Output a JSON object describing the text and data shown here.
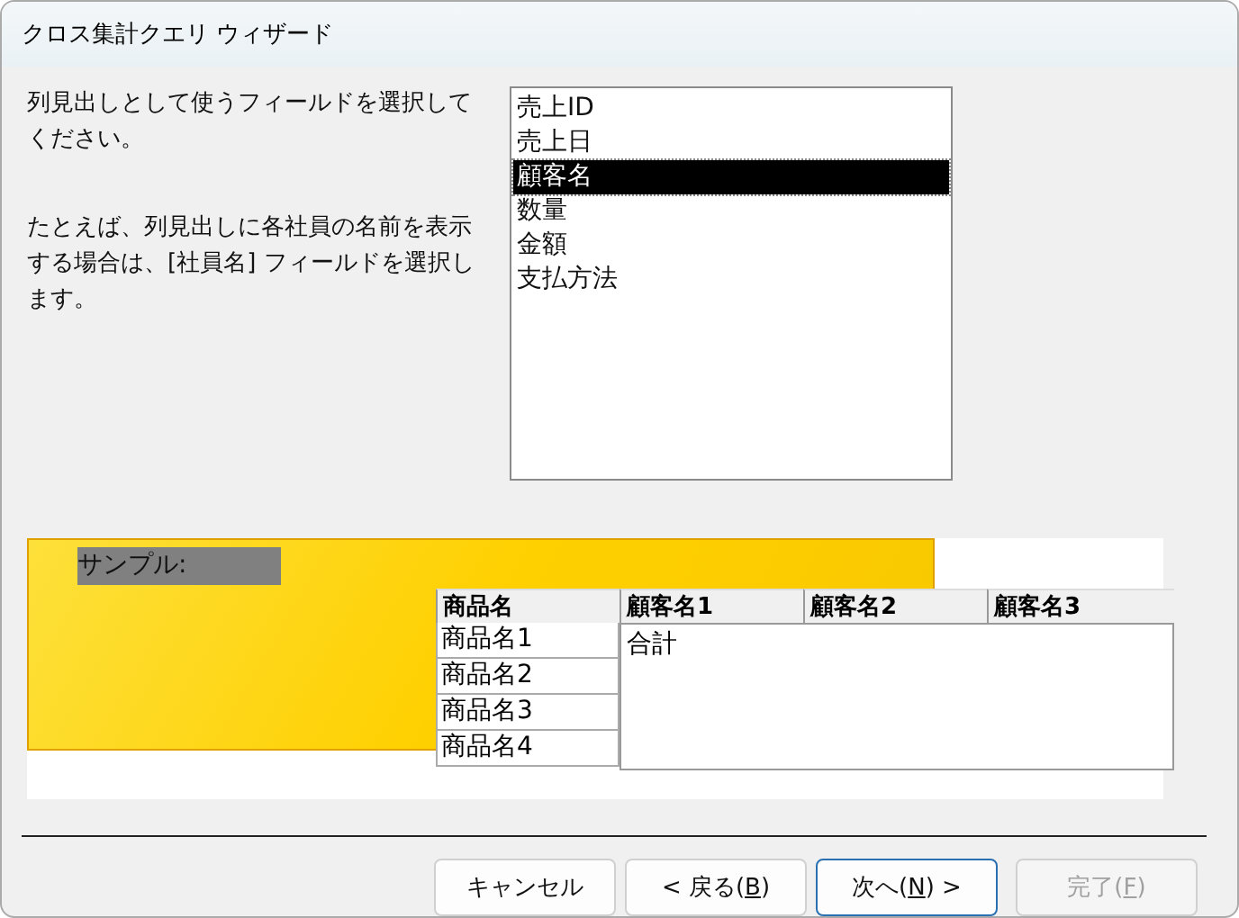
{
  "window": {
    "title": "クロス集計クエリ ウィザード"
  },
  "instructions": [
    "列見出しとして使うフィールドを選択してください。",
    "たとえば、列見出しに各社員の名前を表示する場合は、[社員名] フィールドを選択します。"
  ],
  "fields": [
    {
      "label": "売上ID",
      "selected": false
    },
    {
      "label": "売上日",
      "selected": false
    },
    {
      "label": "顧客名",
      "selected": true
    },
    {
      "label": "数量",
      "selected": false
    },
    {
      "label": "金額",
      "selected": false
    },
    {
      "label": "支払方法",
      "selected": false
    }
  ],
  "sample": {
    "label": "サンプル:",
    "columns": [
      "商品名",
      "顧客名1",
      "顧客名2",
      "顧客名3"
    ],
    "rows": [
      "商品名1",
      "商品名2",
      "商品名3",
      "商品名4"
    ],
    "value": "合計"
  },
  "buttons": [
    {
      "before": "キャンセル",
      "default": false,
      "disabled": false
    },
    {
      "before": "< 戻る(",
      "key": "B",
      "after": ")",
      "default": false,
      "disabled": false
    },
    {
      "before": "次へ(",
      "key": "N",
      "after": ") >",
      "default": true,
      "disabled": false
    },
    {
      "before": "完了(",
      "key": "F",
      "after": ")",
      "default": false,
      "disabled": true
    }
  ]
}
